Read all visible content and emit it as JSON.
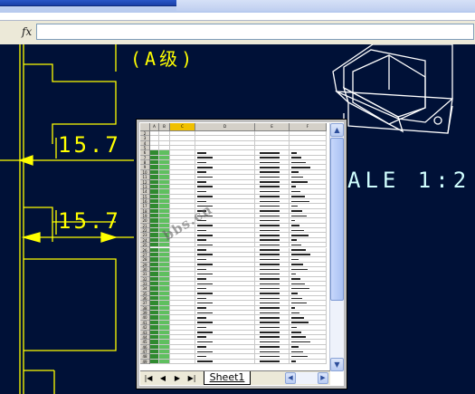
{
  "formula_bar": {
    "fx_label": "fx",
    "value": ""
  },
  "drawing": {
    "grade_text": "(A级)",
    "dim_top": "15.7",
    "dim_bottom": "15.7",
    "scale_text": "ALE 1:2",
    "colors": {
      "background": "#001137",
      "lines": "#ffff00",
      "model": "#ffffff",
      "text_alt": "#d0ffff"
    }
  },
  "spreadsheet": {
    "sheet_tab": "Sheet1",
    "nav_icons": [
      "first-sheet-icon",
      "prev-sheet-icon",
      "next-sheet-icon",
      "last-sheet-icon"
    ],
    "column_headers": [
      "A",
      "B",
      "C",
      "D",
      "E",
      "F"
    ],
    "row_numbers": [
      "2",
      "3",
      "4",
      "5",
      "6",
      "7",
      "8",
      "9",
      "10",
      "11",
      "12",
      "13",
      "14",
      "15",
      "16",
      "17",
      "18",
      "19",
      "20",
      "21",
      "22",
      "23",
      "24",
      "25",
      "26",
      "27",
      "28",
      "29",
      "30",
      "31",
      "32",
      "33",
      "34",
      "35",
      "36",
      "37",
      "38",
      "39",
      "40",
      "41",
      "42",
      "43",
      "44",
      "45",
      "46",
      "47",
      "48",
      "49"
    ],
    "watermark": "bbs.cn"
  }
}
